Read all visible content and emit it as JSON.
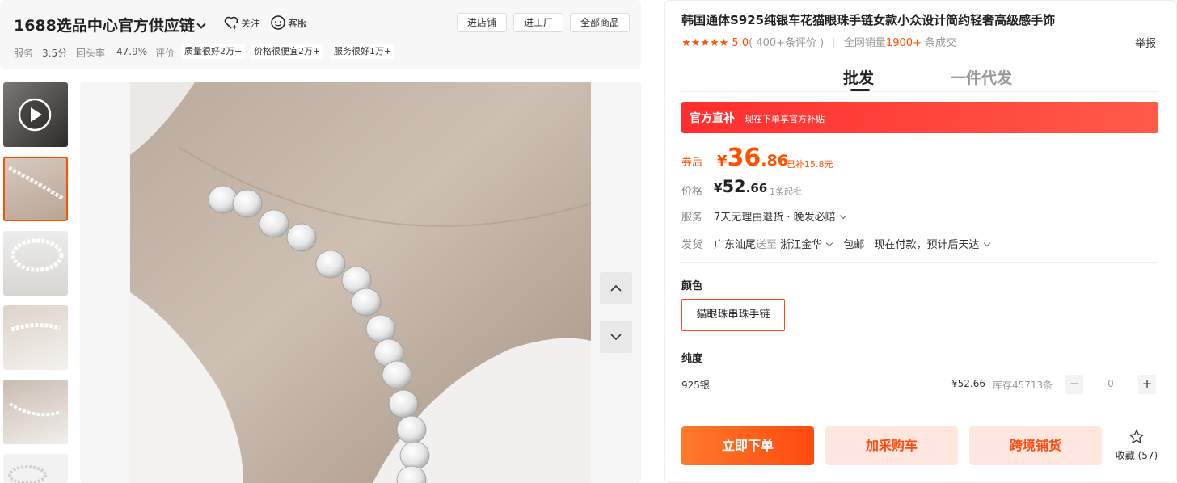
{
  "shop": {
    "name": "1688选品中心官方供应链",
    "follow_label": "关注",
    "service_label": "客服",
    "buttons": [
      "进店铺",
      "进工厂",
      "全部商品"
    ],
    "stats": [
      {
        "label": "服务",
        "value": "3.5分"
      },
      {
        "label": "回头率",
        "value": "47.9%"
      },
      {
        "label": "评价",
        "value": ""
      }
    ],
    "eval_tags": [
      "质量很好2万+",
      "价格很便宜2万+",
      "服务很好1万+"
    ]
  },
  "product": {
    "title": "韩国通体S925纯银车花猫眼珠手链女款小众设计简约轻奢高级感手饰",
    "rating": "5.0",
    "review_count": "( 400+条评价 )",
    "sales_prefix": "全网销量",
    "sales_value": "1900+",
    "sales_suffix": " 条成交",
    "report_label": "举报"
  },
  "tabs": [
    "批发",
    "一件代发"
  ],
  "promo": {
    "title": "官方直补",
    "text": "现在下单享官方补贴"
  },
  "price": {
    "after_coupon_label": "券后",
    "currency": "¥",
    "after_coupon_int": "36",
    "after_coupon_dec": ".86",
    "subsidy": "已补15.8元",
    "price_label": "价格",
    "price_int": "52",
    "price_dec": ".66",
    "moq": "1条起批"
  },
  "service": {
    "label": "服务",
    "items": "7天无理由退货 · 晚发必赔"
  },
  "shipping": {
    "label": "发货",
    "from": "广东汕尾",
    "to_word": "送至",
    "to": "浙江金华",
    "free": "包邮",
    "eta": "现在付款，预计后天达"
  },
  "color": {
    "label": "颜色",
    "option": "猫眼珠串珠手链"
  },
  "purity": {
    "label": "纯度",
    "option": "925银",
    "price": "¥52.66",
    "stock": "库存45713条",
    "qty": "0",
    "minus": "−",
    "plus": "+"
  },
  "actions": {
    "buy": "立即下单",
    "cart": "加采购车",
    "cross": "跨境铺货",
    "fav": "收藏 (57)"
  },
  "colors": {
    "accent": "#ff5000",
    "promo": "#ff3b3b"
  }
}
